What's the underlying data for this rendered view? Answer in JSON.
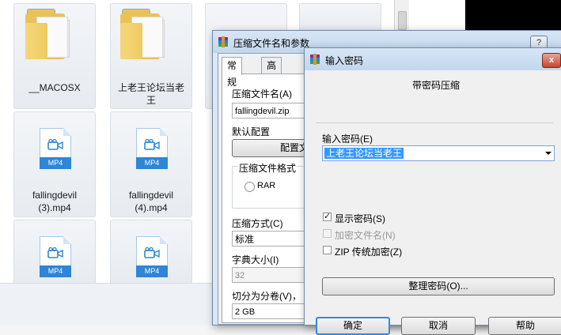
{
  "explorer": {
    "files": [
      {
        "name": "__MACOSX",
        "type": "folder"
      },
      {
        "name": "上老王论坛当老王",
        "type": "folder"
      },
      {
        "name": "fallingdevil (3).mp4",
        "line1": "fallingdevil",
        "line2": "(3).mp4",
        "type": "mp4"
      },
      {
        "name": "fallingdevil (4).mp4",
        "line1": "fallingdevil",
        "line2": "(4).mp4",
        "type": "mp4"
      }
    ],
    "mp4_badge": "MP4",
    "folder2_line1": "上老王论坛当老",
    "folder2_line2": "王"
  },
  "archive_dialog": {
    "title": "压缩文件名和参数",
    "title_buttons": [
      "?",
      "x"
    ],
    "tabs": [
      {
        "label": "常规",
        "active": true
      },
      {
        "label": "高级",
        "active": false
      }
    ],
    "archive_name_label": "压缩文件名(A)",
    "archive_name_value": "fallingdevil.zip",
    "default_profile_label": "默认配置",
    "profiles_button": "配置文",
    "format_group_label": "压缩文件格式",
    "format_rar": "RAR",
    "method_label": "压缩方式(C)",
    "method_value": "标准",
    "dict_label": "字典大小(I)",
    "dict_value": "32",
    "split_label": "切分为分卷(V)，",
    "split_value": "2 GB"
  },
  "password_dialog": {
    "title": "输入密码",
    "close_glyph": "x",
    "heading": "带密码压缩",
    "password_label": "输入密码(E)",
    "password_value": "上老王论坛当老王",
    "show_password": {
      "label": "显示密码(S)",
      "checked": true,
      "enabled": true
    },
    "encrypt_names": {
      "label": "加密文件名(N)",
      "checked": false,
      "enabled": false
    },
    "zip_legacy": {
      "label": "ZIP 传统加密(Z)",
      "checked": false,
      "enabled": true
    },
    "organize_button": "整理密码(O)...",
    "ok_button": "确定",
    "cancel_button": "取消",
    "help_button": "帮助"
  }
}
